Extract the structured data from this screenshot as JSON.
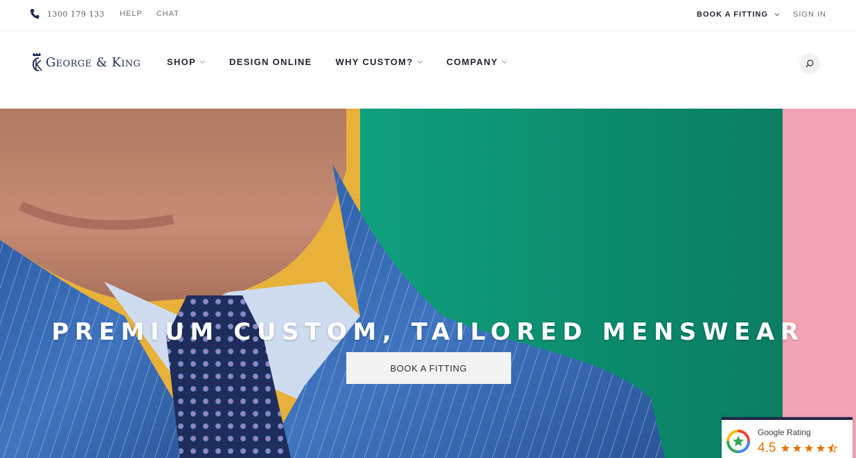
{
  "topbar": {
    "phone": "1300 179 133",
    "help": "HELP",
    "chat": "CHAT",
    "book_fitting": "BOOK A FITTING",
    "sign_in": "SIGN IN"
  },
  "header": {
    "logo_text": "George & King",
    "nav": [
      {
        "label": "SHOP",
        "has_dropdown": true
      },
      {
        "label": "DESIGN ONLINE",
        "has_dropdown": false
      },
      {
        "label": "WHY CUSTOM?",
        "has_dropdown": true
      },
      {
        "label": "COMPANY",
        "has_dropdown": true
      }
    ],
    "search_icon": "search-icon"
  },
  "hero": {
    "headline": "PREMIUM CUSTOM, TAILORED MENSWEAR",
    "cta": "BOOK A FITTING"
  },
  "rating_widget": {
    "label": "Google Rating",
    "score": "4.5",
    "stars": 4.5
  },
  "colors": {
    "brand_navy": "#1e2c55",
    "rating_orange": "#e37400",
    "widget_border": "#22264a"
  }
}
